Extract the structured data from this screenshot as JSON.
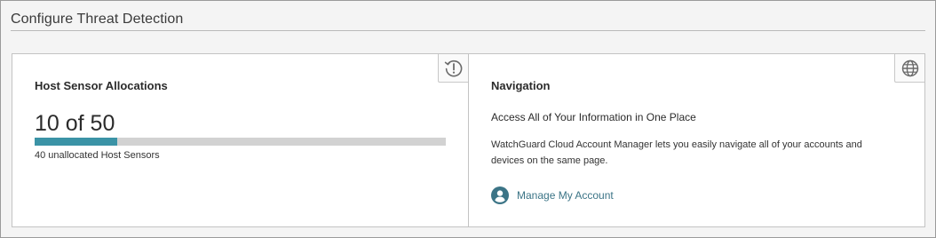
{
  "page": {
    "title": "Configure Threat Detection"
  },
  "host_sensor_card": {
    "heading": "Host Sensor Allocations",
    "count_text": "10 of 50",
    "allocated": 10,
    "total": 50,
    "unallocated_text": "40 unallocated Host Sensors",
    "alert_icon": "alert-history-icon",
    "bar_color": "#3b93a6"
  },
  "navigation_card": {
    "heading": "Navigation",
    "subtitle": "Access All of Your Information in One Place",
    "description": "WatchGuard Cloud Account Manager lets you easily navigate all of your accounts and devices on the same page.",
    "link_label": "Manage My Account",
    "globe_icon": "globe-icon",
    "account_icon": "user-circle-icon",
    "link_color": "#3b7486"
  }
}
